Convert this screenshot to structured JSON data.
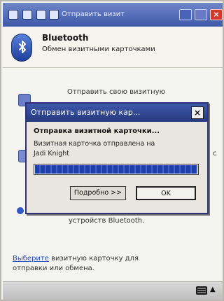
{
  "titlebar": {
    "title": "Отправить визит"
  },
  "header": {
    "title": "Bluetooth",
    "subtitle": "Обмен визитными карточками"
  },
  "background_lines": {
    "send_line": "Отправить свою визитную",
    "right_glyph": "с",
    "device_line": "устройств Bluetooth."
  },
  "dialog": {
    "title": "Отправить визитную кар...",
    "heading": "Отправка визитной карточки...",
    "message": "Визитная карточка отправлена на",
    "target": "Jadi Knight",
    "progress": 1.0,
    "details_button": "Подробно >>",
    "ok_button": "OK"
  },
  "footer_text": {
    "link": "Выберите",
    "line1_rest": " визитную карточку для",
    "line2": "отправки или обмена."
  },
  "colors": {
    "titlebar": "#3e58a8",
    "dialog_title": "#25397c",
    "progress": "#1f3fa8",
    "link": "#2846b8"
  }
}
